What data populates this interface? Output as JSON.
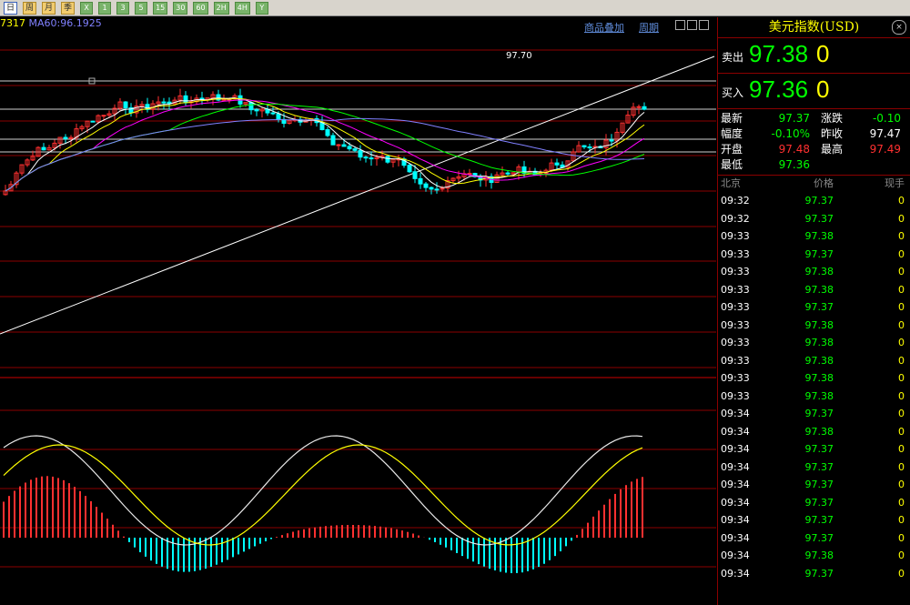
{
  "toolbar": {
    "buttons": [
      "日",
      "周",
      "月",
      "季",
      "X",
      "1",
      "3",
      "5",
      "15",
      "30",
      "60",
      "2H",
      "4H",
      "Y"
    ]
  },
  "chart": {
    "ma_text_left": "7317",
    "ma60_label": "MA60:96.1925",
    "high_label": "97.70",
    "links": [
      "商品叠加",
      "周期"
    ],
    "colors": {
      "up": "#ff3030",
      "down": "#00ffff",
      "ma1": "#ffffff",
      "ma2": "#ffff00",
      "ma3": "#ff00ff",
      "ma4": "#00ff00",
      "ma5": "#8080ff",
      "trend": "#ffffff",
      "grid": "#8b0000"
    }
  },
  "panel": {
    "title": "美元指数(USD)",
    "sell_label": "卖出",
    "sell_price": "97.38",
    "sell_vol": "0",
    "buy_label": "买入",
    "buy_price": "97.36",
    "buy_vol": "0",
    "stats": [
      {
        "k": "最新",
        "v": "97.37",
        "vc": "#00ff00",
        "k2": "涨跌",
        "v2": "-0.10",
        "v2c": "#00ff00"
      },
      {
        "k": "幅度",
        "v": "-0.10%",
        "vc": "#00ff00",
        "k2": "昨收",
        "v2": "97.47",
        "v2c": "#ffffff"
      },
      {
        "k": "开盘",
        "v": "97.48",
        "vc": "#ff3030",
        "k2": "最高",
        "v2": "97.49",
        "v2c": "#ff3030"
      },
      {
        "k": "最低",
        "v": "97.36",
        "vc": "#00ff00",
        "k2": "",
        "v2": "",
        "v2c": "#ffffff"
      }
    ],
    "tick_headers": [
      "北京",
      "价格",
      "现手"
    ],
    "ticks": [
      {
        "t": "09:32",
        "p": "97.37",
        "q": "0"
      },
      {
        "t": "09:32",
        "p": "97.37",
        "q": "0"
      },
      {
        "t": "09:33",
        "p": "97.38",
        "q": "0"
      },
      {
        "t": "09:33",
        "p": "97.37",
        "q": "0"
      },
      {
        "t": "09:33",
        "p": "97.38",
        "q": "0"
      },
      {
        "t": "09:33",
        "p": "97.38",
        "q": "0"
      },
      {
        "t": "09:33",
        "p": "97.37",
        "q": "0"
      },
      {
        "t": "09:33",
        "p": "97.38",
        "q": "0"
      },
      {
        "t": "09:33",
        "p": "97.38",
        "q": "0"
      },
      {
        "t": "09:33",
        "p": "97.38",
        "q": "0"
      },
      {
        "t": "09:33",
        "p": "97.38",
        "q": "0"
      },
      {
        "t": "09:33",
        "p": "97.38",
        "q": "0"
      },
      {
        "t": "09:34",
        "p": "97.37",
        "q": "0"
      },
      {
        "t": "09:34",
        "p": "97.38",
        "q": "0"
      },
      {
        "t": "09:34",
        "p": "97.37",
        "q": "0"
      },
      {
        "t": "09:34",
        "p": "97.37",
        "q": "0"
      },
      {
        "t": "09:34",
        "p": "97.37",
        "q": "0"
      },
      {
        "t": "09:34",
        "p": "97.37",
        "q": "0"
      },
      {
        "t": "09:34",
        "p": "97.37",
        "q": "0"
      },
      {
        "t": "09:34",
        "p": "97.37",
        "q": "0"
      },
      {
        "t": "09:34",
        "p": "97.38",
        "q": "0"
      },
      {
        "t": "09:34",
        "p": "97.37",
        "q": "0"
      }
    ]
  }
}
